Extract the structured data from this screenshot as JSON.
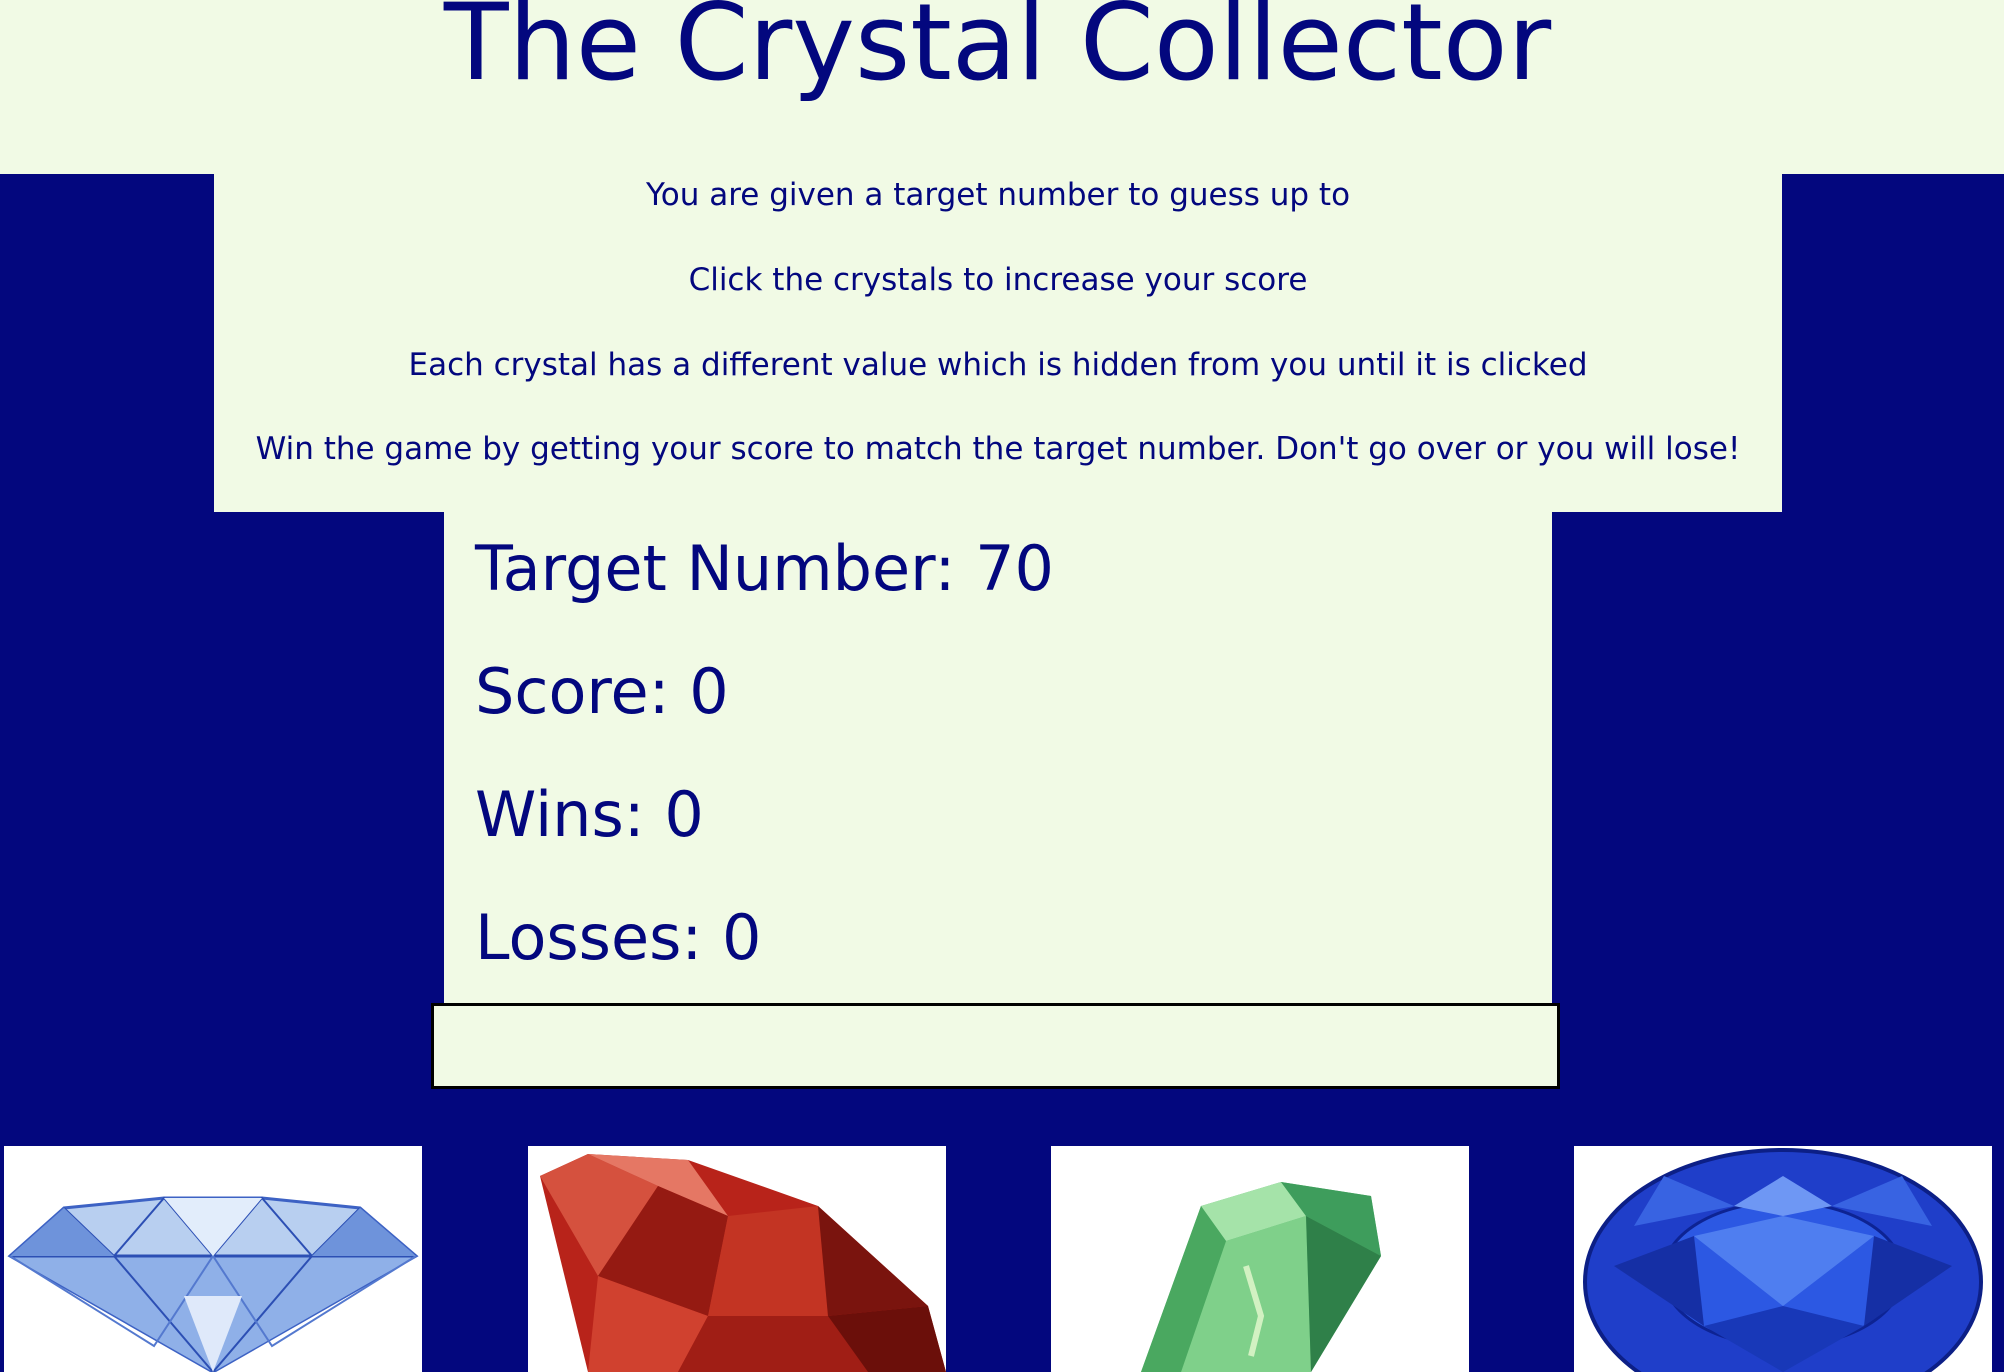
{
  "game": {
    "title": "The Crystal Collector"
  },
  "instructions": [
    "You are given a target number to guess up to",
    "Click the crystals to increase your score",
    "Each crystal has a different value which is hidden from you until it is clicked",
    "Win the game by getting your score to match the target number. Don't go over or you will lose!"
  ],
  "stats": {
    "target": "Target Number: 70",
    "score": "Score: 0",
    "wins": "Wins: 0",
    "losses": "Losses: 0"
  },
  "result_message": "",
  "crystals": [
    {
      "name": "diamond-crystal-icon",
      "color": "#a9c6ec"
    },
    {
      "name": "ruby-crystal-icon",
      "color": "#b8231a"
    },
    {
      "name": "emerald-crystal-icon",
      "color": "#5fbf75"
    },
    {
      "name": "sapphire-crystal-icon",
      "color": "#1f3ec9"
    }
  ],
  "colors": {
    "background": "#03077e",
    "panel": "#f1fae5",
    "text": "#03077e"
  }
}
